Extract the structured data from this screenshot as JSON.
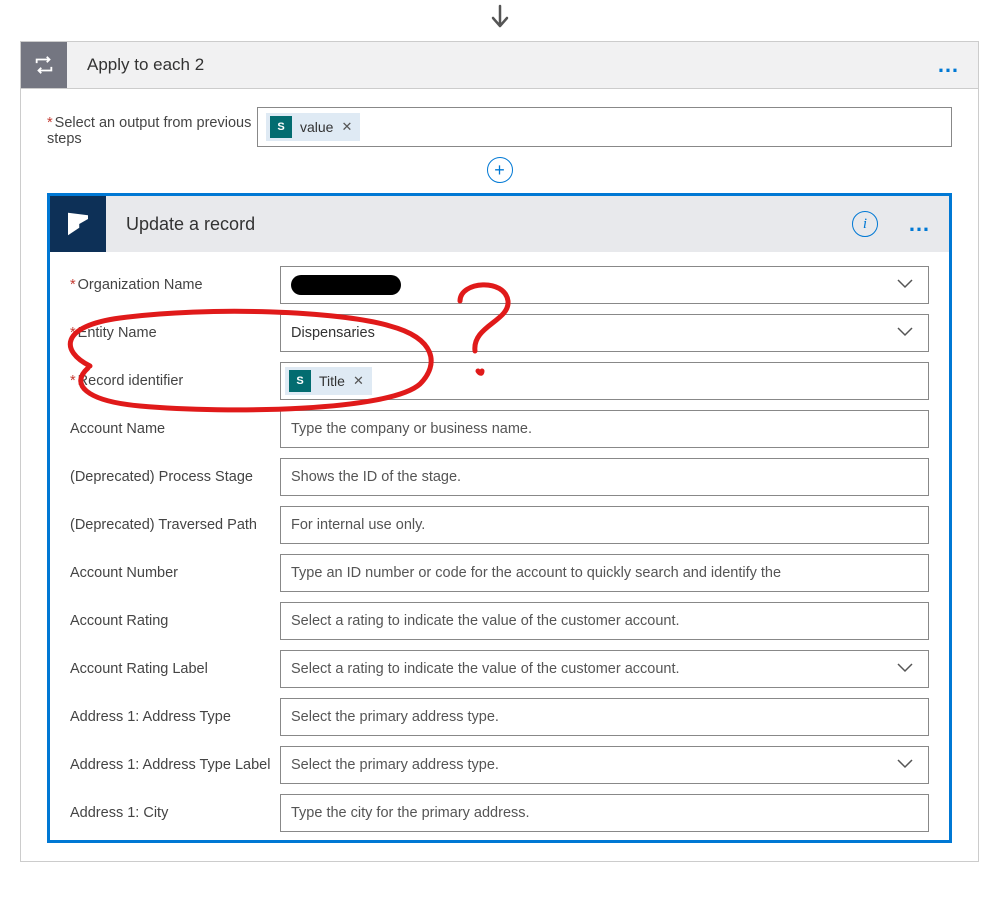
{
  "outer": {
    "title": "Apply to each 2",
    "select_label": "Select an output from previous steps",
    "token": {
      "icon_label": "S",
      "text": "value"
    }
  },
  "inner": {
    "title": "Update a record",
    "fields": [
      {
        "label": "Organization Name",
        "required": true,
        "type": "redacted-dropdown",
        "value": "",
        "placeholder": ""
      },
      {
        "label": "Entity Name",
        "required": true,
        "type": "dropdown",
        "value": "Dispensaries",
        "placeholder": ""
      },
      {
        "label": "Record identifier",
        "required": true,
        "type": "token",
        "token_text": "Title",
        "token_icon": "S"
      },
      {
        "label": "Account Name",
        "required": false,
        "type": "text",
        "value": "",
        "placeholder": "Type the company or business name."
      },
      {
        "label": "(Deprecated) Process Stage",
        "required": false,
        "type": "text",
        "value": "",
        "placeholder": "Shows the ID of the stage."
      },
      {
        "label": "(Deprecated) Traversed Path",
        "required": false,
        "type": "text",
        "value": "",
        "placeholder": "For internal use only."
      },
      {
        "label": "Account Number",
        "required": false,
        "type": "text",
        "value": "",
        "placeholder": "Type an ID number or code for the account to quickly search and identify the"
      },
      {
        "label": "Account Rating",
        "required": false,
        "type": "text",
        "value": "",
        "placeholder": "Select a rating to indicate the value of the customer account."
      },
      {
        "label": "Account Rating Label",
        "required": false,
        "type": "dropdown",
        "value": "",
        "placeholder": "Select a rating to indicate the value of the customer account."
      },
      {
        "label": "Address 1: Address Type",
        "required": false,
        "type": "text",
        "value": "",
        "placeholder": "Select the primary address type."
      },
      {
        "label": "Address 1: Address Type Label",
        "required": false,
        "type": "dropdown",
        "value": "",
        "placeholder": "Select the primary address type."
      },
      {
        "label": "Address 1: City",
        "required": false,
        "type": "text",
        "value": "",
        "placeholder": "Type the city for the primary address."
      }
    ]
  }
}
